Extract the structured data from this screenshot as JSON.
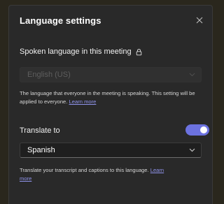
{
  "dialog": {
    "title": "Language settings",
    "close_icon": "close-icon"
  },
  "spoken_language": {
    "label": "Spoken language in this meeting",
    "info_icon": "lock-info-icon",
    "selected": "English (US)",
    "disabled": true,
    "help_text": "The language that everyone in the meeting is speaking. This setting will be applied to everyone.",
    "learn_more": "Learn more"
  },
  "translate": {
    "label": "Translate to",
    "toggle_on": true,
    "selected": "Spanish",
    "help_text": "Translate your transcript and captions to this language.",
    "learn_more": "Learn more"
  },
  "colors": {
    "background": "#292929",
    "accent": "#6c72e0",
    "link": "#8f93ea"
  }
}
